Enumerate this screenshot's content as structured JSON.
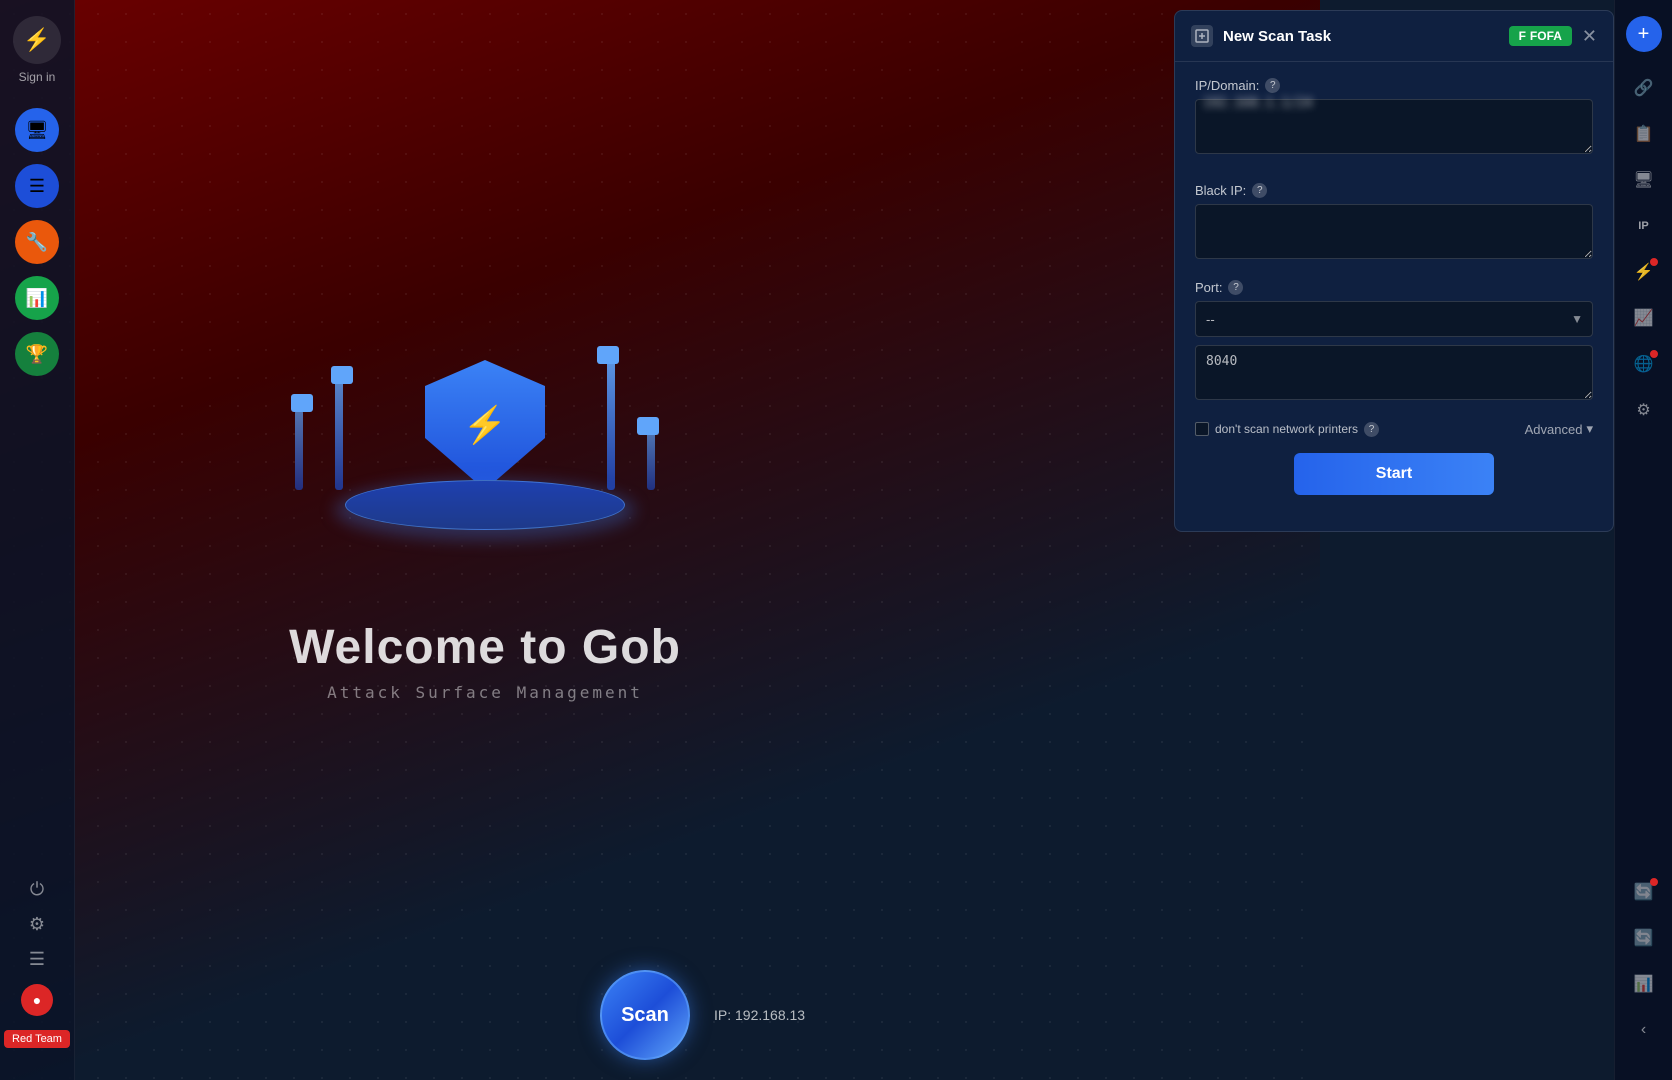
{
  "app": {
    "title": "Welcome to Gob",
    "subtitle": "Attack Surface Management",
    "sign_in_label": "Sign in"
  },
  "sidebar": {
    "logo_icon": "⚡",
    "sign_in": "Sign in",
    "nav_items": [
      {
        "id": "nav-1",
        "icon": "🖥",
        "color": "blue"
      },
      {
        "id": "nav-2",
        "icon": "☰",
        "color": "blue2"
      },
      {
        "id": "nav-3",
        "icon": "🔧",
        "color": "orange"
      },
      {
        "id": "nav-4",
        "icon": "📊",
        "color": "green"
      },
      {
        "id": "nav-5",
        "icon": "🏆",
        "color": "green2"
      }
    ],
    "bottom": {
      "power_icon": "⏻",
      "settings_icon": "⚙",
      "menu_icon": "☰",
      "red_dot_icon": "🔴",
      "red_team_label": "Red Team"
    }
  },
  "illustration": {
    "welcome_title": "Welcome to Gob",
    "welcome_subtitle": "Attack Surface Management"
  },
  "scan_bottom": {
    "scan_label": "Scan",
    "ip_label": "IP:  192.168.13"
  },
  "dialog": {
    "title": "New Scan Task",
    "fofa_label": "FOFA",
    "fofa_icon": "F",
    "close_icon": "✕",
    "fields": {
      "ip_domain_label": "IP/Domain:",
      "ip_domain_placeholder": "192.168.1.1",
      "ip_domain_value": "••• ••• •••",
      "black_ip_label": "Black IP:",
      "black_ip_placeholder": "",
      "port_label": "Port:",
      "port_select_value": "--",
      "port_custom_value": "8040",
      "dont_scan_printers_label": "don't scan network printers",
      "advanced_label": "Advanced",
      "start_label": "Start"
    }
  },
  "right_sidebar": {
    "add_icon": "+",
    "icons": [
      {
        "id": "rs-1",
        "symbol": "🔗",
        "has_dot": false
      },
      {
        "id": "rs-2",
        "symbol": "📋",
        "has_dot": false
      },
      {
        "id": "rs-3",
        "symbol": "🖥",
        "has_dot": false
      },
      {
        "id": "rs-4",
        "symbol": "IP",
        "has_dot": false
      },
      {
        "id": "rs-5",
        "symbol": "⚡",
        "has_dot": false
      },
      {
        "id": "rs-6",
        "symbol": "📈",
        "has_dot": false
      },
      {
        "id": "rs-7",
        "symbol": "🌐",
        "has_dot": false
      },
      {
        "id": "rs-8",
        "symbol": "⚙",
        "has_dot": false
      }
    ],
    "bottom_icons": [
      {
        "id": "rsb-1",
        "symbol": "🔄",
        "has_dot": true
      },
      {
        "id": "rsb-2",
        "symbol": "🔄",
        "has_dot": false
      },
      {
        "id": "rsb-3",
        "symbol": "📊",
        "has_dot": false
      },
      {
        "id": "rsb-4",
        "symbol": "‹",
        "has_dot": false
      }
    ]
  }
}
